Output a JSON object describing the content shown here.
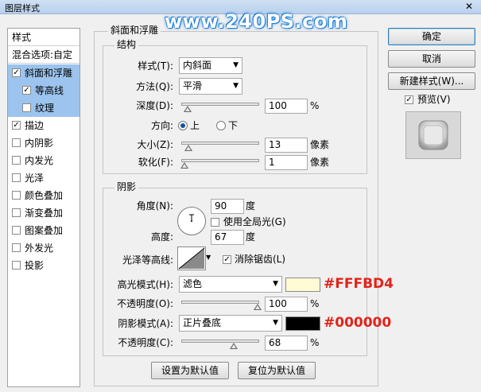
{
  "window": {
    "title": "图层样式",
    "close_glyph": "✕"
  },
  "watermark": "www.240PS.com",
  "left_panel": {
    "header": "样式",
    "blend_options": "混合选项:自定",
    "items": [
      {
        "label": "斜面和浮雕",
        "checked": true,
        "selected": true
      },
      {
        "label": "等高线",
        "checked": true,
        "selected": true
      },
      {
        "label": "纹理",
        "checked": false,
        "selected": true
      },
      {
        "label": "描边",
        "checked": true,
        "selected": false
      },
      {
        "label": "内阴影",
        "checked": false,
        "selected": false
      },
      {
        "label": "内发光",
        "checked": false,
        "selected": false
      },
      {
        "label": "光泽",
        "checked": false,
        "selected": false
      },
      {
        "label": "颜色叠加",
        "checked": false,
        "selected": false
      },
      {
        "label": "渐变叠加",
        "checked": false,
        "selected": false
      },
      {
        "label": "图案叠加",
        "checked": false,
        "selected": false
      },
      {
        "label": "外发光",
        "checked": false,
        "selected": false
      },
      {
        "label": "投影",
        "checked": false,
        "selected": false
      }
    ]
  },
  "bevel": {
    "section_title": "斜面和浮雕",
    "structure_title": "结构",
    "style_label": "样式(T):",
    "style_value": "内斜面",
    "technique_label": "方法(Q):",
    "technique_value": "平滑",
    "depth_label": "深度(D):",
    "depth_value": "100",
    "depth_unit": "%",
    "direction_label": "方向:",
    "direction_up": "上",
    "direction_down": "下",
    "size_label": "大小(Z):",
    "size_value": "13",
    "size_unit": "像素",
    "soften_label": "软化(F):",
    "soften_value": "1",
    "soften_unit": "像素"
  },
  "shading": {
    "title": "阴影",
    "angle_label": "角度(N):",
    "angle_value": "90",
    "angle_unit": "度",
    "global_light_label": "使用全局光(G)",
    "altitude_label": "高度:",
    "altitude_value": "67",
    "altitude_unit": "度",
    "gloss_contour_label": "光泽等高线:",
    "antialias_label": "消除锯齿(L)",
    "highlight_mode_label": "高光模式(H):",
    "highlight_mode_value": "滤色",
    "highlight_color": "#FFFBD4",
    "highlight_color_label": "#FFFBD4",
    "highlight_opacity_label": "不透明度(O):",
    "highlight_opacity_value": "100",
    "highlight_opacity_unit": "%",
    "shadow_mode_label": "阴影模式(A):",
    "shadow_mode_value": "正片叠底",
    "shadow_color": "#000000",
    "shadow_color_label": "#000000",
    "shadow_opacity_label": "不透明度(C):",
    "shadow_opacity_value": "68",
    "shadow_opacity_unit": "%"
  },
  "footer": {
    "set_default": "设置为默认值",
    "reset_default": "复位为默认值"
  },
  "right": {
    "ok": "确定",
    "cancel": "取消",
    "new_style": "新建样式(W)...",
    "preview": "预览(V)"
  },
  "accent_selection": "#9cc4ee",
  "annotation_color": "#e2231a"
}
